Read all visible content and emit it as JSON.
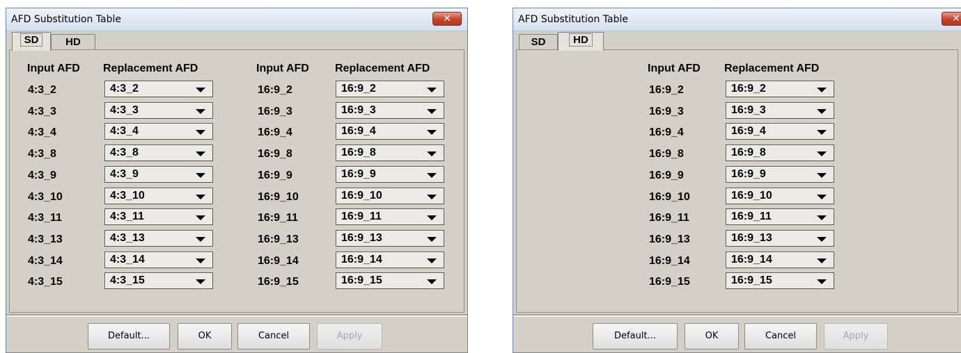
{
  "left": {
    "title": "AFD Substitution Table",
    "close_glyph": "✕",
    "tabs": [
      {
        "label": "SD",
        "active": true
      },
      {
        "label": "HD",
        "active": false
      }
    ],
    "headers": {
      "input": "Input AFD",
      "replacement": "Replacement AFD"
    },
    "sd_rows": [
      {
        "input": "4:3_2",
        "replacement": "4:3_2"
      },
      {
        "input": "4:3_3",
        "replacement": "4:3_3"
      },
      {
        "input": "4:3_4",
        "replacement": "4:3_4"
      },
      {
        "input": "4:3_8",
        "replacement": "4:3_8"
      },
      {
        "input": "4:3_9",
        "replacement": "4:3_9"
      },
      {
        "input": "4:3_10",
        "replacement": "4:3_10"
      },
      {
        "input": "4:3_11",
        "replacement": "4:3_11"
      },
      {
        "input": "4:3_13",
        "replacement": "4:3_13"
      },
      {
        "input": "4:3_14",
        "replacement": "4:3_14"
      },
      {
        "input": "4:3_15",
        "replacement": "4:3_15"
      }
    ],
    "wide_rows": [
      {
        "input": "16:9_2",
        "replacement": "16:9_2"
      },
      {
        "input": "16:9_3",
        "replacement": "16:9_3"
      },
      {
        "input": "16:9_4",
        "replacement": "16:9_4"
      },
      {
        "input": "16:9_8",
        "replacement": "16:9_8"
      },
      {
        "input": "16:9_9",
        "replacement": "16:9_9"
      },
      {
        "input": "16:9_10",
        "replacement": "16:9_10"
      },
      {
        "input": "16:9_11",
        "replacement": "16:9_11"
      },
      {
        "input": "16:9_13",
        "replacement": "16:9_13"
      },
      {
        "input": "16:9_14",
        "replacement": "16:9_14"
      },
      {
        "input": "16:9_15",
        "replacement": "16:9_15"
      }
    ],
    "buttons": {
      "default": "Default...",
      "ok": "OK",
      "cancel": "Cancel",
      "apply": "Apply"
    }
  },
  "right": {
    "title": "AFD Substitution Table",
    "close_glyph": "✕",
    "tabs": [
      {
        "label": "SD",
        "active": false
      },
      {
        "label": "HD",
        "active": true
      }
    ],
    "headers": {
      "input": "Input AFD",
      "replacement": "Replacement AFD"
    },
    "rows": [
      {
        "input": "16:9_2",
        "replacement": "16:9_2"
      },
      {
        "input": "16:9_3",
        "replacement": "16:9_3"
      },
      {
        "input": "16:9_4",
        "replacement": "16:9_4"
      },
      {
        "input": "16:9_8",
        "replacement": "16:9_8"
      },
      {
        "input": "16:9_9",
        "replacement": "16:9_9"
      },
      {
        "input": "16:9_10",
        "replacement": "16:9_10"
      },
      {
        "input": "16:9_11",
        "replacement": "16:9_11"
      },
      {
        "input": "16:9_13",
        "replacement": "16:9_13"
      },
      {
        "input": "16:9_14",
        "replacement": "16:9_14"
      },
      {
        "input": "16:9_15",
        "replacement": "16:9_15"
      }
    ],
    "buttons": {
      "default": "Default...",
      "ok": "OK",
      "cancel": "Cancel",
      "apply": "Apply"
    }
  },
  "colors": {
    "dialog_bg": "#d4d0c8",
    "close_button": "#c4412b",
    "title_bar": "#dfe8f3"
  }
}
